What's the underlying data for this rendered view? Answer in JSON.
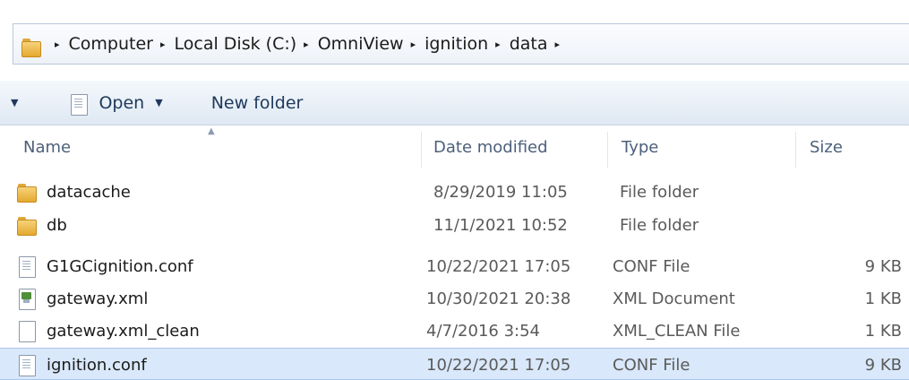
{
  "address_bar": {
    "folder_icon": "folder-icon",
    "breadcrumbs": [
      "Computer",
      "Local Disk (C:)",
      "OmniView",
      "ignition",
      "data"
    ],
    "separator": "▸"
  },
  "toolbar": {
    "open_label": "Open",
    "new_folder_label": "New folder"
  },
  "columns": {
    "name": "Name",
    "date_modified": "Date modified",
    "type": "Type",
    "size": "Size"
  },
  "files": [
    {
      "name": "datacache",
      "date": "8/29/2019 11:05",
      "type": "File folder",
      "size": "",
      "icon": "folder-icon"
    },
    {
      "name": "db",
      "date": "11/1/2021 10:52",
      "type": "File folder",
      "size": "",
      "icon": "folder-icon"
    },
    {
      "name": "G1GCignition.conf",
      "date": "10/22/2021 17:05",
      "type": "CONF File",
      "size": "9 KB",
      "icon": "document-icon"
    },
    {
      "name": "gateway.xml",
      "date": "10/30/2021 20:38",
      "type": "XML Document",
      "size": "1 KB",
      "icon": "xml-document-icon"
    },
    {
      "name": "gateway.xml_clean",
      "date": "4/7/2016 3:54",
      "type": "XML_CLEAN File",
      "size": "1 KB",
      "icon": "blank-file-icon"
    },
    {
      "name": "ignition.conf",
      "date": "10/22/2021 17:05",
      "type": "CONF File",
      "size": "9 KB",
      "icon": "document-icon",
      "selected": true
    }
  ],
  "colors": {
    "selection_bg": "#d9e8fa",
    "toolbar_text": "#1e395b",
    "header_text": "#4c607a"
  }
}
